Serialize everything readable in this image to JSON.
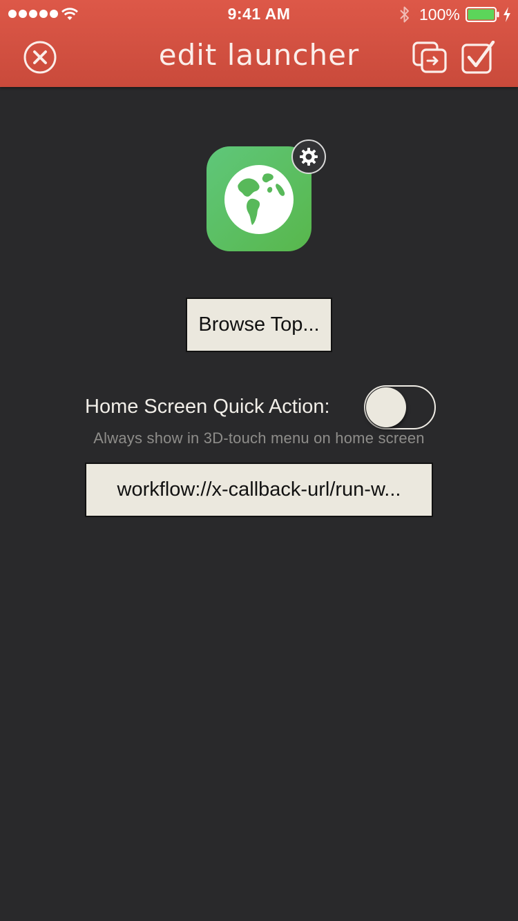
{
  "status_bar": {
    "time": "9:41 AM",
    "battery_percent": "100%",
    "signal_bars": 5,
    "battery_level": 1.0
  },
  "header": {
    "title": "edit launcher",
    "close_icon": "close-circle-icon",
    "copy_icon": "copy-icon",
    "done_icon": "checkbox-check-icon",
    "background_color": "#dd5848"
  },
  "launcher": {
    "icon": "globe-icon",
    "icon_color": "#5cbf5c",
    "settings_icon": "gear-icon",
    "name_button_label": "Browse Top...",
    "quick_action_label": "Home Screen Quick Action:",
    "quick_action_enabled": false,
    "quick_action_subtitle": "Always show in 3D-touch menu on home screen",
    "url_value": "workflow://x-callback-url/run-w..."
  }
}
